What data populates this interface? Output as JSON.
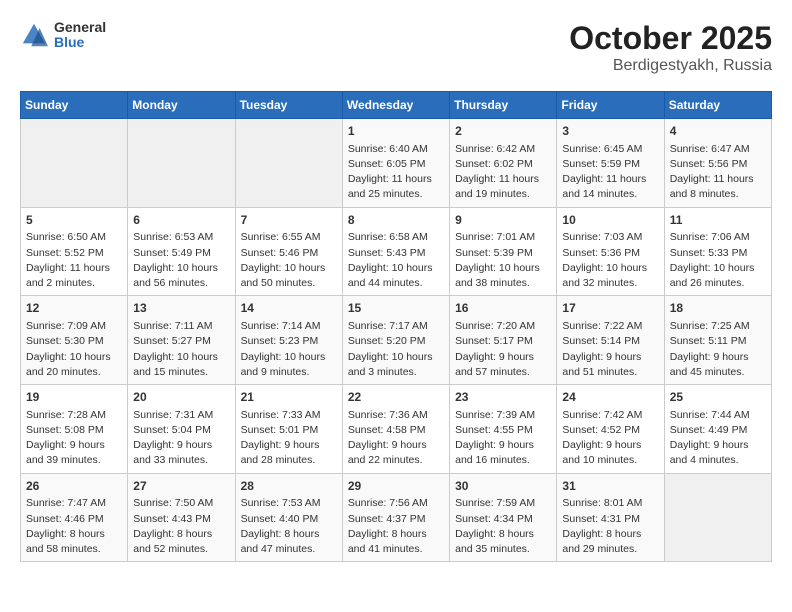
{
  "header": {
    "logo": {
      "general": "General",
      "blue": "Blue"
    },
    "title": "October 2025",
    "subtitle": "Berdigestyakh, Russia"
  },
  "weekdays": [
    "Sunday",
    "Monday",
    "Tuesday",
    "Wednesday",
    "Thursday",
    "Friday",
    "Saturday"
  ],
  "weeks": [
    [
      {
        "day": "",
        "empty": true
      },
      {
        "day": "",
        "empty": true
      },
      {
        "day": "",
        "empty": true
      },
      {
        "day": "1",
        "sunrise": "Sunrise: 6:40 AM",
        "sunset": "Sunset: 6:05 PM",
        "daylight": "Daylight: 11 hours and 25 minutes."
      },
      {
        "day": "2",
        "sunrise": "Sunrise: 6:42 AM",
        "sunset": "Sunset: 6:02 PM",
        "daylight": "Daylight: 11 hours and 19 minutes."
      },
      {
        "day": "3",
        "sunrise": "Sunrise: 6:45 AM",
        "sunset": "Sunset: 5:59 PM",
        "daylight": "Daylight: 11 hours and 14 minutes."
      },
      {
        "day": "4",
        "sunrise": "Sunrise: 6:47 AM",
        "sunset": "Sunset: 5:56 PM",
        "daylight": "Daylight: 11 hours and 8 minutes."
      }
    ],
    [
      {
        "day": "5",
        "sunrise": "Sunrise: 6:50 AM",
        "sunset": "Sunset: 5:52 PM",
        "daylight": "Daylight: 11 hours and 2 minutes."
      },
      {
        "day": "6",
        "sunrise": "Sunrise: 6:53 AM",
        "sunset": "Sunset: 5:49 PM",
        "daylight": "Daylight: 10 hours and 56 minutes."
      },
      {
        "day": "7",
        "sunrise": "Sunrise: 6:55 AM",
        "sunset": "Sunset: 5:46 PM",
        "daylight": "Daylight: 10 hours and 50 minutes."
      },
      {
        "day": "8",
        "sunrise": "Sunrise: 6:58 AM",
        "sunset": "Sunset: 5:43 PM",
        "daylight": "Daylight: 10 hours and 44 minutes."
      },
      {
        "day": "9",
        "sunrise": "Sunrise: 7:01 AM",
        "sunset": "Sunset: 5:39 PM",
        "daylight": "Daylight: 10 hours and 38 minutes."
      },
      {
        "day": "10",
        "sunrise": "Sunrise: 7:03 AM",
        "sunset": "Sunset: 5:36 PM",
        "daylight": "Daylight: 10 hours and 32 minutes."
      },
      {
        "day": "11",
        "sunrise": "Sunrise: 7:06 AM",
        "sunset": "Sunset: 5:33 PM",
        "daylight": "Daylight: 10 hours and 26 minutes."
      }
    ],
    [
      {
        "day": "12",
        "sunrise": "Sunrise: 7:09 AM",
        "sunset": "Sunset: 5:30 PM",
        "daylight": "Daylight: 10 hours and 20 minutes."
      },
      {
        "day": "13",
        "sunrise": "Sunrise: 7:11 AM",
        "sunset": "Sunset: 5:27 PM",
        "daylight": "Daylight: 10 hours and 15 minutes."
      },
      {
        "day": "14",
        "sunrise": "Sunrise: 7:14 AM",
        "sunset": "Sunset: 5:23 PM",
        "daylight": "Daylight: 10 hours and 9 minutes."
      },
      {
        "day": "15",
        "sunrise": "Sunrise: 7:17 AM",
        "sunset": "Sunset: 5:20 PM",
        "daylight": "Daylight: 10 hours and 3 minutes."
      },
      {
        "day": "16",
        "sunrise": "Sunrise: 7:20 AM",
        "sunset": "Sunset: 5:17 PM",
        "daylight": "Daylight: 9 hours and 57 minutes."
      },
      {
        "day": "17",
        "sunrise": "Sunrise: 7:22 AM",
        "sunset": "Sunset: 5:14 PM",
        "daylight": "Daylight: 9 hours and 51 minutes."
      },
      {
        "day": "18",
        "sunrise": "Sunrise: 7:25 AM",
        "sunset": "Sunset: 5:11 PM",
        "daylight": "Daylight: 9 hours and 45 minutes."
      }
    ],
    [
      {
        "day": "19",
        "sunrise": "Sunrise: 7:28 AM",
        "sunset": "Sunset: 5:08 PM",
        "daylight": "Daylight: 9 hours and 39 minutes."
      },
      {
        "day": "20",
        "sunrise": "Sunrise: 7:31 AM",
        "sunset": "Sunset: 5:04 PM",
        "daylight": "Daylight: 9 hours and 33 minutes."
      },
      {
        "day": "21",
        "sunrise": "Sunrise: 7:33 AM",
        "sunset": "Sunset: 5:01 PM",
        "daylight": "Daylight: 9 hours and 28 minutes."
      },
      {
        "day": "22",
        "sunrise": "Sunrise: 7:36 AM",
        "sunset": "Sunset: 4:58 PM",
        "daylight": "Daylight: 9 hours and 22 minutes."
      },
      {
        "day": "23",
        "sunrise": "Sunrise: 7:39 AM",
        "sunset": "Sunset: 4:55 PM",
        "daylight": "Daylight: 9 hours and 16 minutes."
      },
      {
        "day": "24",
        "sunrise": "Sunrise: 7:42 AM",
        "sunset": "Sunset: 4:52 PM",
        "daylight": "Daylight: 9 hours and 10 minutes."
      },
      {
        "day": "25",
        "sunrise": "Sunrise: 7:44 AM",
        "sunset": "Sunset: 4:49 PM",
        "daylight": "Daylight: 9 hours and 4 minutes."
      }
    ],
    [
      {
        "day": "26",
        "sunrise": "Sunrise: 7:47 AM",
        "sunset": "Sunset: 4:46 PM",
        "daylight": "Daylight: 8 hours and 58 minutes."
      },
      {
        "day": "27",
        "sunrise": "Sunrise: 7:50 AM",
        "sunset": "Sunset: 4:43 PM",
        "daylight": "Daylight: 8 hours and 52 minutes."
      },
      {
        "day": "28",
        "sunrise": "Sunrise: 7:53 AM",
        "sunset": "Sunset: 4:40 PM",
        "daylight": "Daylight: 8 hours and 47 minutes."
      },
      {
        "day": "29",
        "sunrise": "Sunrise: 7:56 AM",
        "sunset": "Sunset: 4:37 PM",
        "daylight": "Daylight: 8 hours and 41 minutes."
      },
      {
        "day": "30",
        "sunrise": "Sunrise: 7:59 AM",
        "sunset": "Sunset: 4:34 PM",
        "daylight": "Daylight: 8 hours and 35 minutes."
      },
      {
        "day": "31",
        "sunrise": "Sunrise: 8:01 AM",
        "sunset": "Sunset: 4:31 PM",
        "daylight": "Daylight: 8 hours and 29 minutes."
      },
      {
        "day": "",
        "empty": true
      }
    ]
  ]
}
